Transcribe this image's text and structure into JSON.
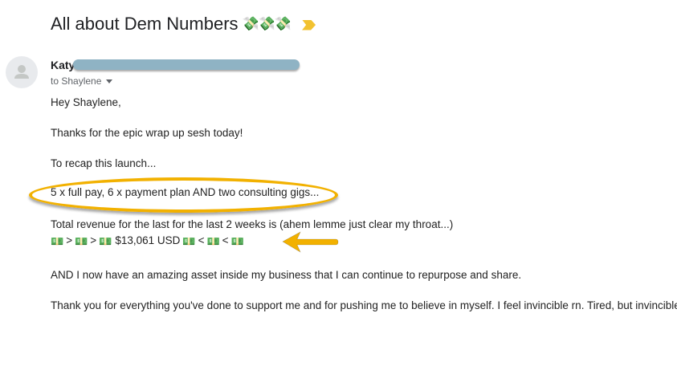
{
  "email": {
    "subject": "All about Dem Numbers",
    "subject_emoji": "💸💸💸",
    "sender_name": "Katy",
    "recipient_label": "to Shaylene",
    "body": {
      "greeting": "Hey Shaylene,",
      "line_thanks": "Thanks for the epic wrap up sesh today!",
      "line_recap": "To recap this launch...",
      "line_sales": "5 x full pay, 6 x payment plan AND two consulting gigs...",
      "line_revenue": "Total revenue for the last for the last 2 weeks is (ahem lemme just clear my throat...)",
      "revenue_amount": "$13,061 USD",
      "bill_emoji": "💵",
      "symbol_gt": ">",
      "symbol_lt": "<",
      "line_asset": "AND I now have an amazing asset inside my business that I can continue to repurpose and share.",
      "line_closing": "Thank you for everything you've done to support me and for pushing me to believe in myself. I feel invincible rn. Tired, but invincible",
      "closing_emoji": "⚡"
    }
  },
  "colors": {
    "annotation": "#f2b100",
    "redaction": "#8fb3c4",
    "importance_marker": "#f2c230"
  }
}
